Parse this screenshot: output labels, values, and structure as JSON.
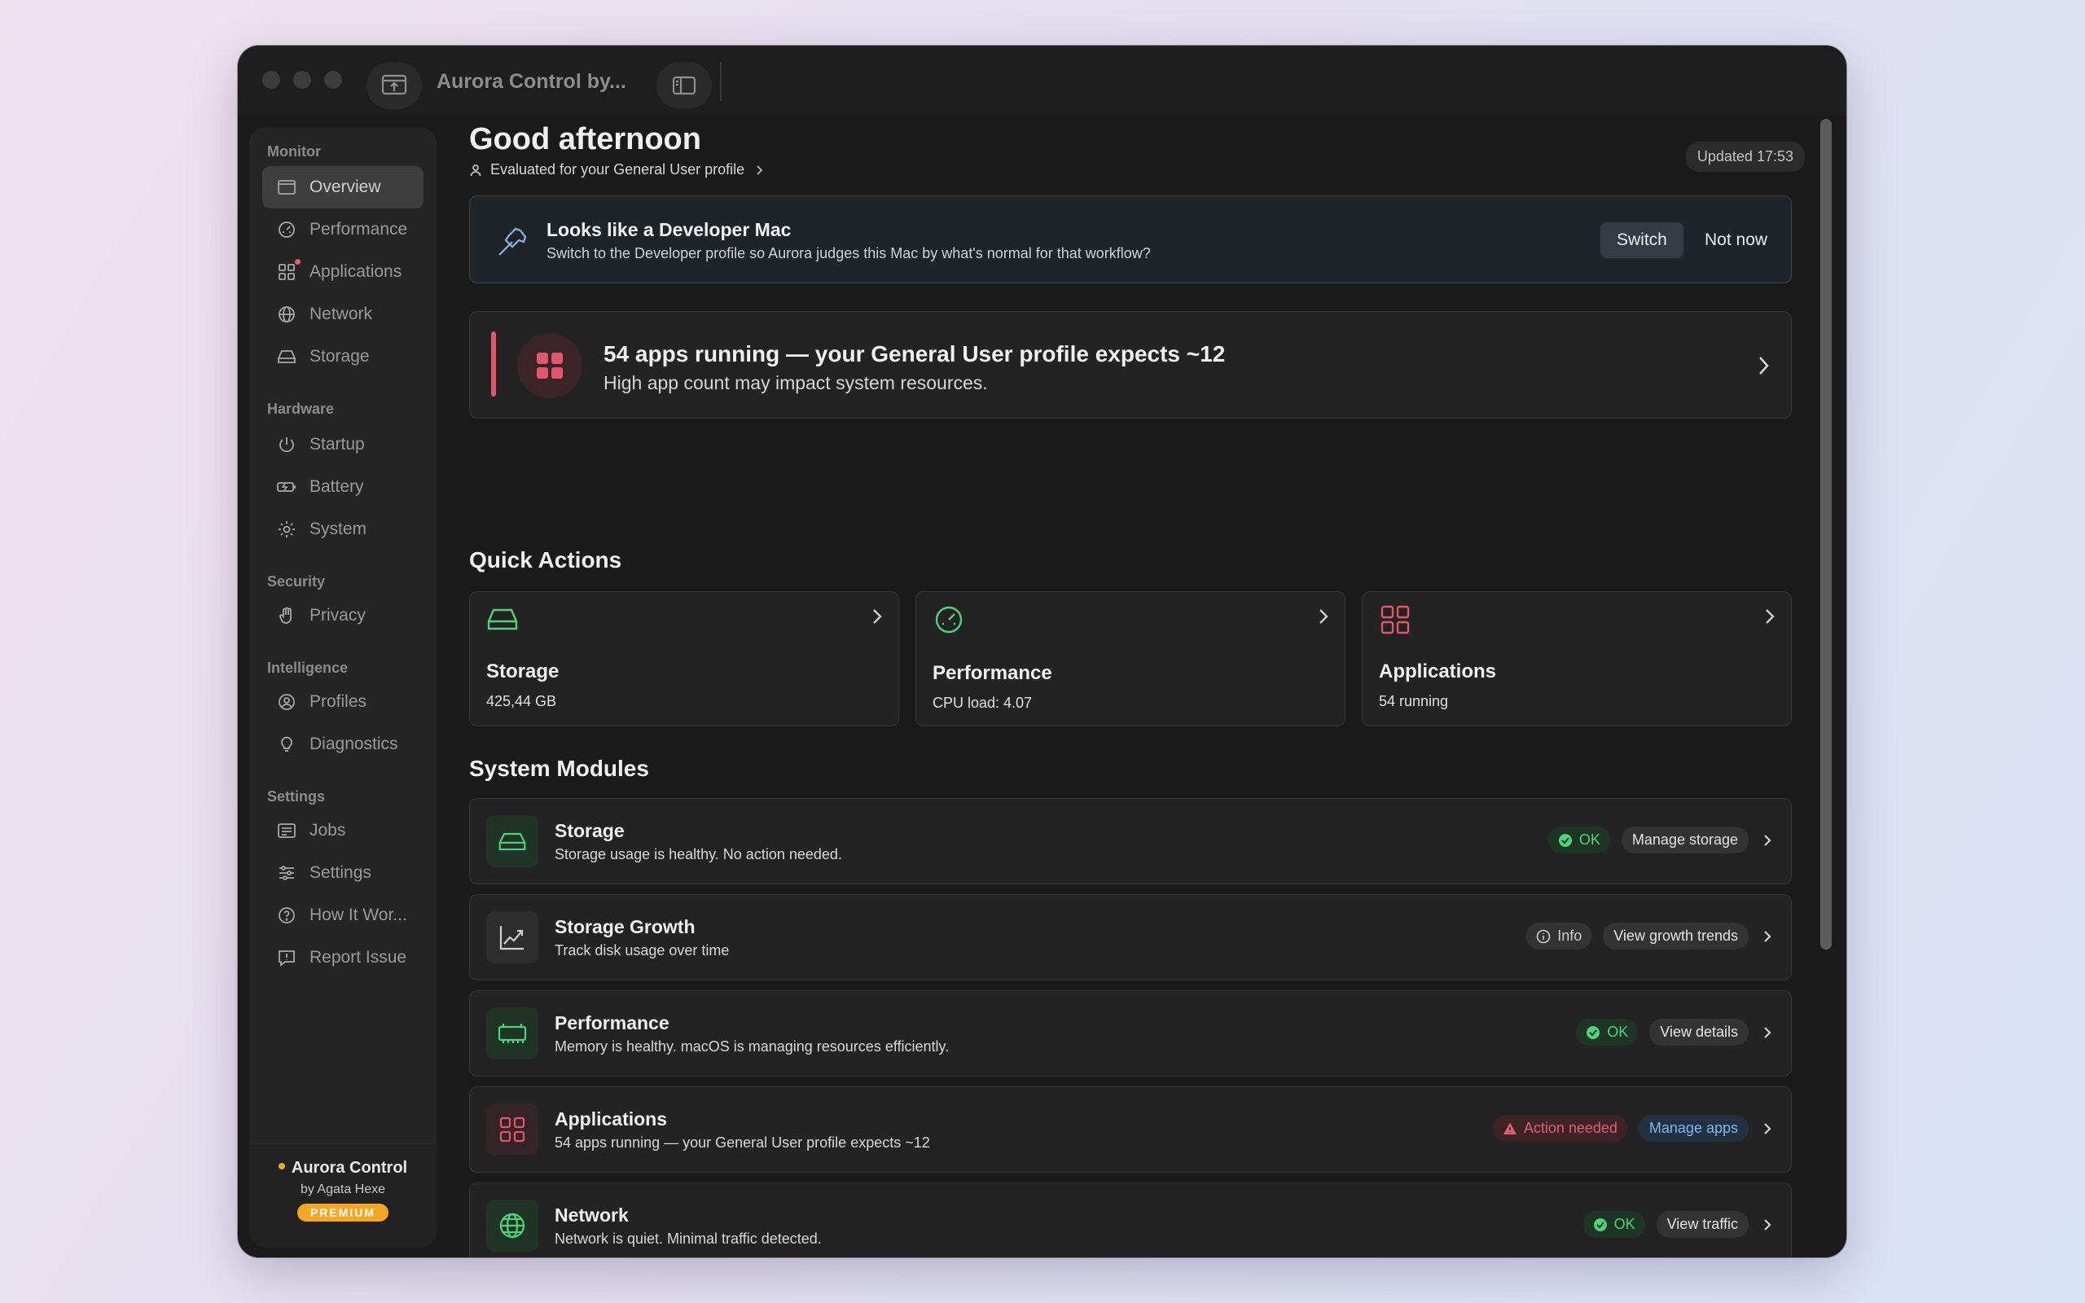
{
  "window": {
    "title": "Aurora Control by..."
  },
  "sidebar": {
    "groups": {
      "monitor": "Monitor",
      "hardware": "Hardware",
      "security": "Security",
      "intelligence": "Intelligence",
      "settings": "Settings"
    },
    "items": {
      "overview": "Overview",
      "performance": "Performance",
      "applications": "Applications",
      "network": "Network",
      "storage": "Storage",
      "startup": "Startup",
      "battery": "Battery",
      "system": "System",
      "privacy": "Privacy",
      "profiles": "Profiles",
      "diagnostics": "Diagnostics",
      "jobs": "Jobs",
      "settings": "Settings",
      "how_it_works": "How It Wor...",
      "report_issue": "Report Issue"
    },
    "footer": {
      "brand": "Aurora Control",
      "by": "by Agata Hexe",
      "badge": "PREMIUM"
    }
  },
  "header": {
    "greeting": "Good afternoon",
    "profile_link": "Evaluated for your General User profile",
    "updated": "Updated 17:53"
  },
  "dev_banner": {
    "title": "Looks like a Developer Mac",
    "subtitle": "Switch to the Developer profile so Aurora judges this Mac by what's normal for that workflow?",
    "switch_label": "Switch",
    "dismiss_label": "Not now"
  },
  "alert": {
    "title": "54 apps running — your General User profile expects ~12",
    "subtitle": "High app count may impact system resources."
  },
  "quick_actions": {
    "title": "Quick Actions",
    "items": [
      {
        "name": "Storage",
        "value": "425,44 GB"
      },
      {
        "name": "Performance",
        "value": "CPU load: 4.07"
      },
      {
        "name": "Applications",
        "value": "54 running"
      }
    ]
  },
  "modules": {
    "title": "System Modules",
    "items": [
      {
        "title": "Storage",
        "subtitle": "Storage usage is healthy. No action needed.",
        "status": "OK",
        "action": "Manage storage"
      },
      {
        "title": "Storage Growth",
        "subtitle": "Track disk usage over time",
        "status": "Info",
        "action": "View growth trends"
      },
      {
        "title": "Performance",
        "subtitle": "Memory is healthy. macOS is managing resources efficiently.",
        "status": "OK",
        "action": "View details"
      },
      {
        "title": "Applications",
        "subtitle": "54 apps running — your General User profile expects ~12",
        "status": "Action needed",
        "action": "Manage apps"
      },
      {
        "title": "Network",
        "subtitle": "Network is quiet. Minimal traffic detected.",
        "status": "OK",
        "action": "View traffic"
      }
    ]
  },
  "colors": {
    "ok": "#4fd27a",
    "warn": "#e0606f",
    "accent_blue": "#7fb6ef",
    "premium": "#f5a623"
  }
}
